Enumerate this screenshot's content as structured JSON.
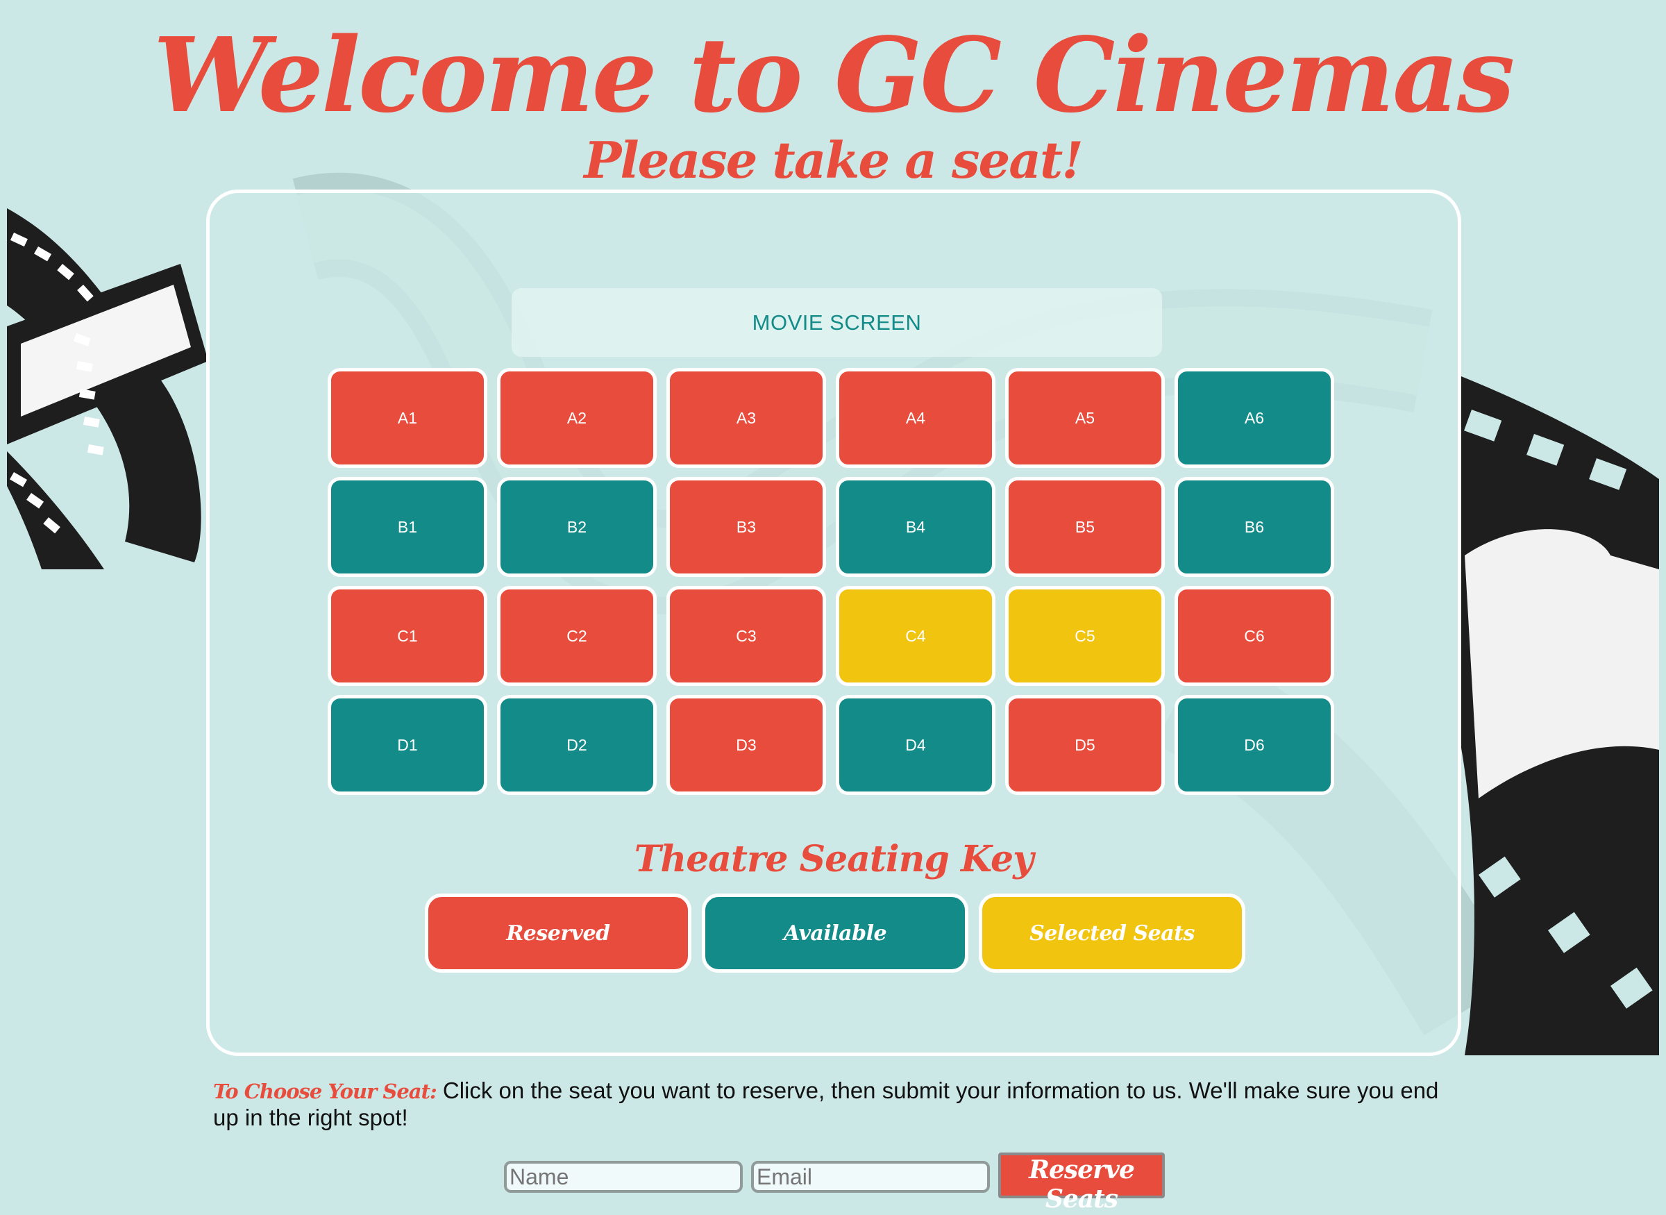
{
  "header": {
    "title": "Welcome to GC Cinemas",
    "subtitle": "Please take a seat!"
  },
  "theatre": {
    "screen_label": "MOVIE SCREEN",
    "seats": [
      {
        "label": "A1",
        "status": "reserved"
      },
      {
        "label": "A2",
        "status": "reserved"
      },
      {
        "label": "A3",
        "status": "reserved"
      },
      {
        "label": "A4",
        "status": "reserved"
      },
      {
        "label": "A5",
        "status": "reserved"
      },
      {
        "label": "A6",
        "status": "available"
      },
      {
        "label": "B1",
        "status": "available"
      },
      {
        "label": "B2",
        "status": "available"
      },
      {
        "label": "B3",
        "status": "reserved"
      },
      {
        "label": "B4",
        "status": "available"
      },
      {
        "label": "B5",
        "status": "reserved"
      },
      {
        "label": "B6",
        "status": "available"
      },
      {
        "label": "C1",
        "status": "reserved"
      },
      {
        "label": "C2",
        "status": "reserved"
      },
      {
        "label": "C3",
        "status": "reserved"
      },
      {
        "label": "C4",
        "status": "selected"
      },
      {
        "label": "C5",
        "status": "selected"
      },
      {
        "label": "C6",
        "status": "reserved"
      },
      {
        "label": "D1",
        "status": "available"
      },
      {
        "label": "D2",
        "status": "available"
      },
      {
        "label": "D3",
        "status": "reserved"
      },
      {
        "label": "D4",
        "status": "available"
      },
      {
        "label": "D5",
        "status": "reserved"
      },
      {
        "label": "D6",
        "status": "available"
      }
    ],
    "key_title": "Theatre Seating Key",
    "key": [
      {
        "label": "Reserved",
        "status": "reserved"
      },
      {
        "label": "Available",
        "status": "available"
      },
      {
        "label": "Selected Seats",
        "status": "selected"
      }
    ]
  },
  "instructions": {
    "lead": "To Choose Your Seat:",
    "text": " Click on the seat you want to reserve, then submit your information to us. We'll make sure you end up in the right spot!"
  },
  "form": {
    "name_placeholder": "Name",
    "email_placeholder": "Email",
    "submit_label": "Reserve Seats"
  },
  "colors": {
    "reserved": "#e84c3d",
    "available": "#138b89",
    "selected": "#f1c40f",
    "background": "#cbe7e6",
    "accent": "#e84c3d"
  },
  "icons": {
    "background_decoration": "film-strip-icon"
  }
}
